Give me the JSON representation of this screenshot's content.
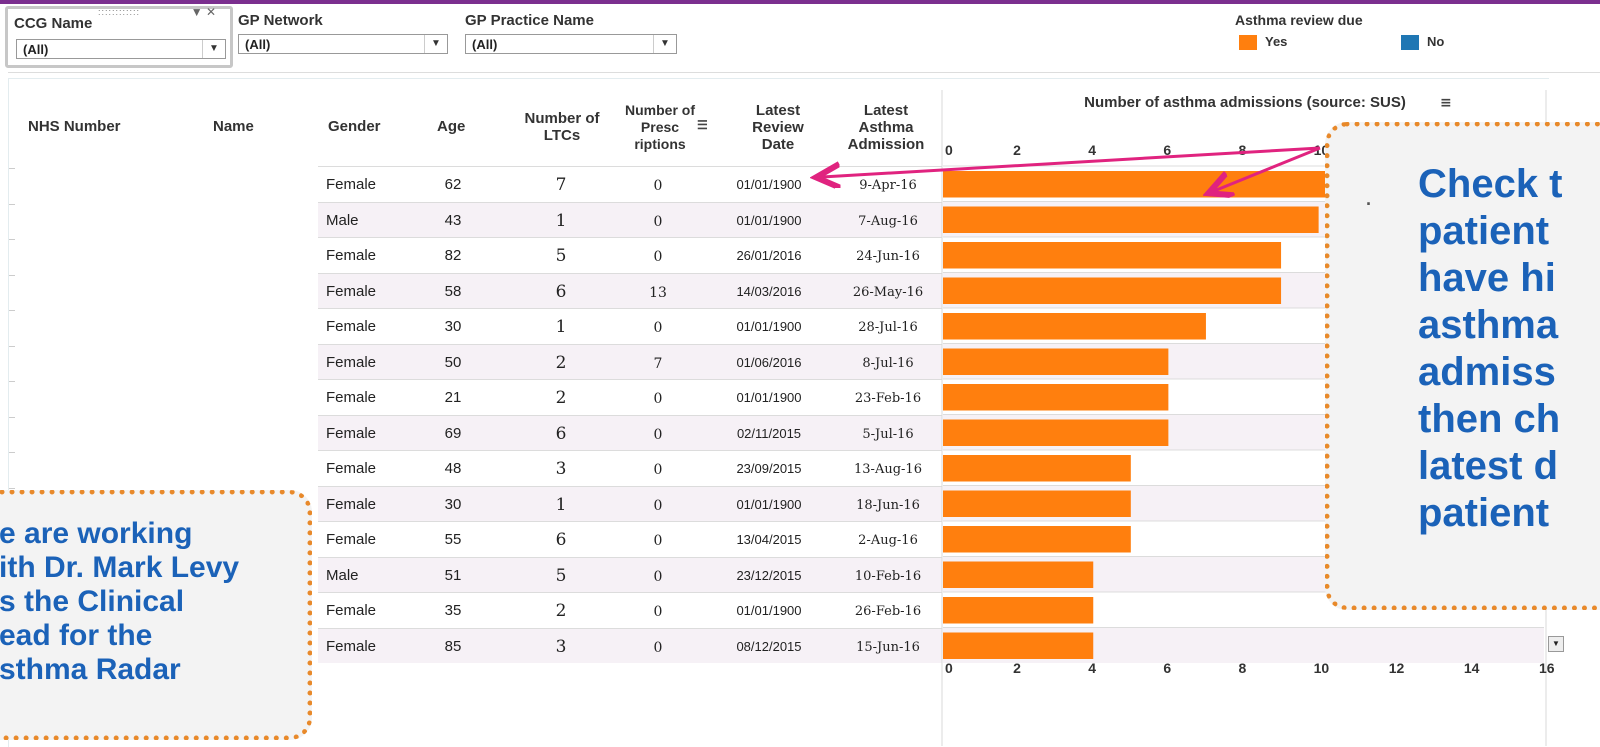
{
  "filters": {
    "ccg": {
      "label": "CCG Name",
      "value": "(All)"
    },
    "gp_network": {
      "label": "GP Network",
      "value": "(All)"
    },
    "gp_practice": {
      "label": "GP Practice Name",
      "value": "(All)"
    }
  },
  "legend": {
    "title": "Asthma review due",
    "items": [
      {
        "label": "Yes",
        "color": "#ff7f0e"
      },
      {
        "label": "No",
        "color": "#1f77b4"
      }
    ]
  },
  "table": {
    "headers": {
      "nhs": "NHS Number",
      "name": "Name",
      "gender": "Gender",
      "age": "Age",
      "ltcs": "Number of LTCs",
      "prescriptions": "Number of Presc riptions",
      "review": "Latest Review Date",
      "admission": "Latest Asthma Admission"
    },
    "rows": [
      {
        "gender": "Female",
        "age": "62",
        "ltcs": "7",
        "prescriptions": "0",
        "review": "01/01/1900",
        "admission": "9-Apr-16"
      },
      {
        "gender": "Male",
        "age": "43",
        "ltcs": "1",
        "prescriptions": "0",
        "review": "01/01/1900",
        "admission": "7-Aug-16"
      },
      {
        "gender": "Female",
        "age": "82",
        "ltcs": "5",
        "prescriptions": "0",
        "review": "26/01/2016",
        "admission": "24-Jun-16"
      },
      {
        "gender": "Female",
        "age": "58",
        "ltcs": "6",
        "prescriptions": "13",
        "review": "14/03/2016",
        "admission": "26-May-16"
      },
      {
        "gender": "Female",
        "age": "30",
        "ltcs": "1",
        "prescriptions": "0",
        "review": "01/01/1900",
        "admission": "28-Jul-16"
      },
      {
        "gender": "Female",
        "age": "50",
        "ltcs": "2",
        "prescriptions": "7",
        "review": "01/06/2016",
        "admission": "8-Jul-16"
      },
      {
        "gender": "Female",
        "age": "21",
        "ltcs": "2",
        "prescriptions": "0",
        "review": "01/01/1900",
        "admission": "23-Feb-16"
      },
      {
        "gender": "Female",
        "age": "69",
        "ltcs": "6",
        "prescriptions": "0",
        "review": "02/11/2015",
        "admission": "5-Jul-16"
      },
      {
        "gender": "Female",
        "age": "48",
        "ltcs": "3",
        "prescriptions": "0",
        "review": "23/09/2015",
        "admission": "13-Aug-16"
      },
      {
        "gender": "Female",
        "age": "30",
        "ltcs": "1",
        "prescriptions": "0",
        "review": "01/01/1900",
        "admission": "18-Jun-16"
      },
      {
        "gender": "Female",
        "age": "55",
        "ltcs": "6",
        "prescriptions": "0",
        "review": "13/04/2015",
        "admission": "2-Aug-16"
      },
      {
        "gender": "Male",
        "age": "51",
        "ltcs": "5",
        "prescriptions": "0",
        "review": "23/12/2015",
        "admission": "10-Feb-16"
      },
      {
        "gender": "Female",
        "age": "35",
        "ltcs": "2",
        "prescriptions": "0",
        "review": "01/01/1900",
        "admission": "26-Feb-16"
      },
      {
        "gender": "Female",
        "age": "85",
        "ltcs": "3",
        "prescriptions": "0",
        "review": "08/12/2015",
        "admission": "15-Jun-16"
      }
    ]
  },
  "chart_data": {
    "type": "bar",
    "orientation": "horizontal",
    "title": "Number of asthma admissions (source: SUS)",
    "values": [
      11,
      10,
      9,
      9,
      7,
      6,
      6,
      6,
      5,
      5,
      5,
      4,
      4,
      4
    ],
    "xlim": [
      0,
      16
    ],
    "ticks": [
      "0",
      "2",
      "4",
      "6",
      "8",
      "10",
      "12",
      "14",
      "16"
    ],
    "bar_color": "#ff7f0e"
  },
  "annotations": {
    "right": {
      "lines": [
        "Check t",
        "patient",
        "have hi",
        "asthma",
        "admiss",
        "then ch",
        "latest d",
        "patient"
      ],
      "bullet": "·"
    },
    "left": {
      "lines": [
        "e are working",
        "ith Dr. Mark Levy",
        "s the Clinical",
        "ead for the",
        "sthma Radar"
      ]
    },
    "arrow_color": "#e0237f"
  }
}
